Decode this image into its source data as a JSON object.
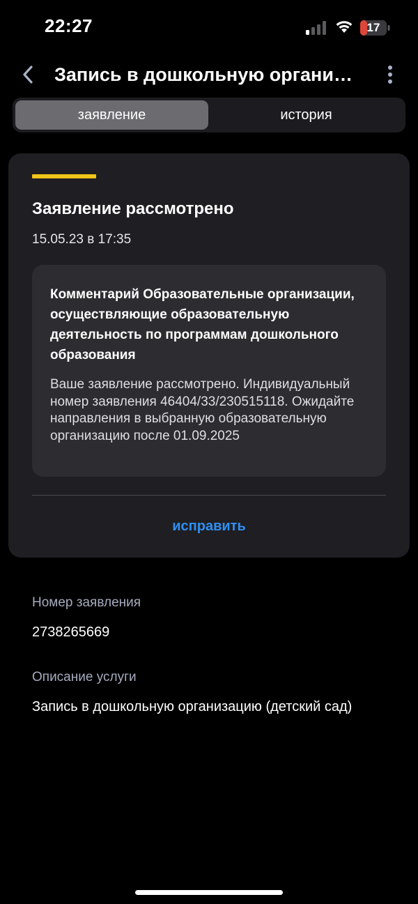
{
  "status_bar": {
    "time": "22:27",
    "battery_level": "17",
    "battery_color": "#e0453a"
  },
  "header": {
    "title": "Запись в дошкольную организацию (детский сад)"
  },
  "tabs": [
    {
      "label": "заявление",
      "active": true
    },
    {
      "label": "история",
      "active": false
    }
  ],
  "card": {
    "status_color": "#f0c419",
    "title": "Заявление рассмотрено",
    "date": "15.05.23 в 17:35",
    "comment": {
      "heading": "Комментарий Образовательные организации, осуществляющие образовательную деятельность по программам дошкольного образования",
      "body": "Ваше заявление рассмотрено. Индивидуальный номер заявления 46404/33/230515118. Ожидайте направления в выбранную образовательную организацию после 01.09.2025"
    },
    "edit_label": "исправить",
    "accent_color": "#2f8ff0"
  },
  "details": {
    "number_label": "Номер заявления",
    "number_value": "2738265669",
    "description_label": "Описание услуги",
    "description_value": "Запись в дошкольную организацию (детский сад)"
  }
}
